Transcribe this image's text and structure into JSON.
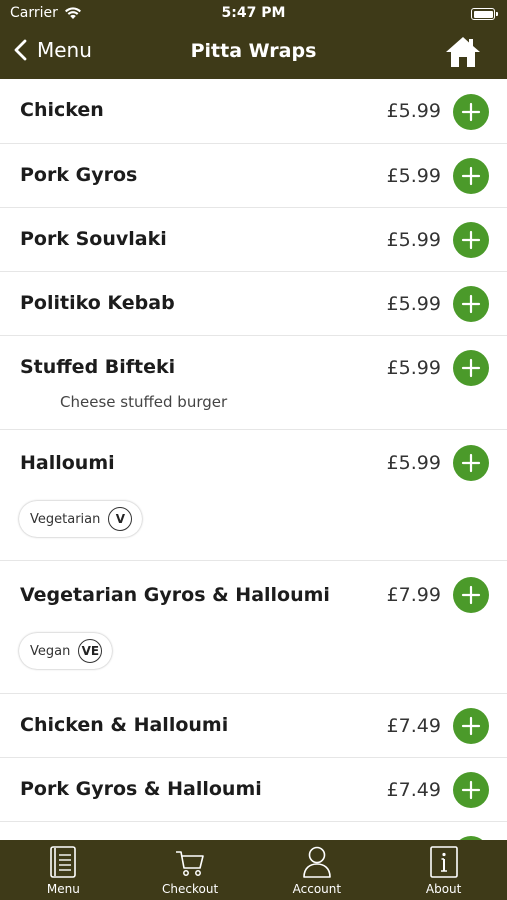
{
  "status_bar": {
    "carrier": "Carrier",
    "time": "5:47 PM"
  },
  "nav": {
    "back_label": "Menu",
    "title": "Pitta Wraps"
  },
  "items": [
    {
      "name": "Chicken",
      "price": "£5.99"
    },
    {
      "name": "Pork Gyros",
      "price": "£5.99"
    },
    {
      "name": "Pork Souvlaki",
      "price": "£5.99"
    },
    {
      "name": "Politiko Kebab",
      "price": "£5.99"
    },
    {
      "name": "Stuffed Bifteki",
      "price": "£5.99",
      "description": "Cheese stuffed burger"
    },
    {
      "name": "Halloumi",
      "price": "£5.99",
      "tag": {
        "label": "Vegetarian",
        "badge": "V"
      }
    },
    {
      "name": "Vegetarian Gyros & Halloumi",
      "price": "£7.99",
      "tag": {
        "label": "Vegan",
        "badge": "VE"
      }
    },
    {
      "name": "Chicken & Halloumi",
      "price": "£7.49"
    },
    {
      "name": "Pork Gyros & Halloumi",
      "price": "£7.49"
    }
  ],
  "tabs": [
    {
      "label": "Menu",
      "icon": "menu-book-icon"
    },
    {
      "label": "Checkout",
      "icon": "cart-icon"
    },
    {
      "label": "Account",
      "icon": "person-icon"
    },
    {
      "label": "About",
      "icon": "info-icon"
    }
  ],
  "colors": {
    "bar": "#3e3a18",
    "add_button": "#4b9a2a"
  }
}
